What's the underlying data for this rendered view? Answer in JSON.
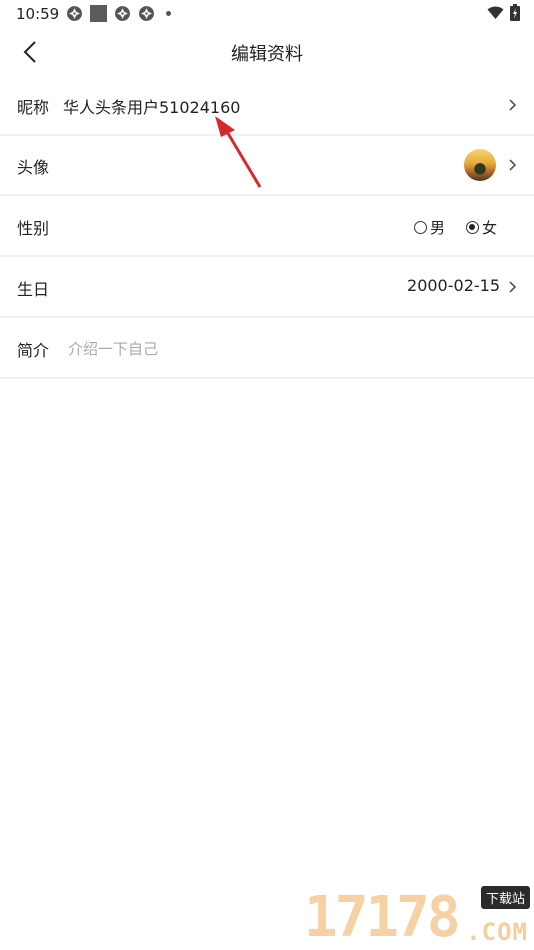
{
  "status_bar": {
    "time": "10:59"
  },
  "header": {
    "title": "编辑资料"
  },
  "rows": {
    "nickname": {
      "label": "昵称",
      "value": "华人头条用户51024160"
    },
    "avatar": {
      "label": "头像"
    },
    "gender": {
      "label": "性别",
      "options": [
        "男",
        "女"
      ],
      "selected": "女"
    },
    "birthday": {
      "label": "生日",
      "value": "2000-02-15"
    },
    "bio": {
      "label": "简介",
      "placeholder": "介绍一下自己"
    }
  },
  "watermark": {
    "digits": "17178",
    "site": "下载站",
    "domain": ".COM"
  },
  "colors": {
    "text": "#222222",
    "placeholder": "#aaaaaa",
    "divider": "#f1f1f1",
    "arrow": "#d9282a"
  }
}
